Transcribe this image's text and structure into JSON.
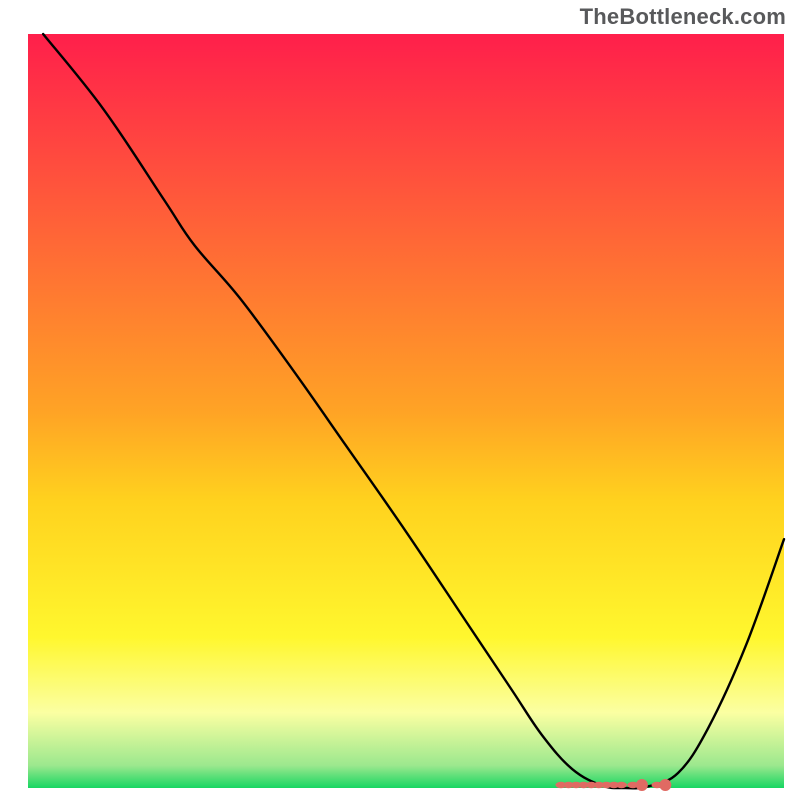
{
  "watermark": "TheBottleneck.com",
  "chart_data": {
    "type": "line",
    "title": "",
    "xlabel": "",
    "ylabel": "",
    "xlim": [
      0,
      100
    ],
    "ylim": [
      0,
      100
    ],
    "grid": false,
    "legend": false,
    "gradient_stops": [
      {
        "y_pct": 0,
        "color": "#ff1f4b"
      },
      {
        "y_pct": 50,
        "color": "#ffa325"
      },
      {
        "y_pct": 62,
        "color": "#ffd21e"
      },
      {
        "y_pct": 80,
        "color": "#fff72e"
      },
      {
        "y_pct": 90,
        "color": "#fbffa2"
      },
      {
        "y_pct": 97,
        "color": "#9ce88e"
      },
      {
        "y_pct": 100,
        "color": "#17d662"
      }
    ],
    "series": [
      {
        "name": "bottleneck-curve",
        "color": "#000000",
        "stroke_width": 2.4,
        "x": [
          2,
          10,
          18,
          22,
          28,
          35,
          42,
          50,
          58,
          64,
          68,
          72,
          76,
          79,
          82,
          86,
          90,
          95,
          100
        ],
        "y": [
          100,
          90,
          78,
          72,
          65,
          55.5,
          45.5,
          34,
          22,
          13,
          7,
          2.5,
          0.3,
          0,
          0.2,
          2,
          8,
          19,
          33
        ]
      }
    ],
    "markers": {
      "name": "optimal-band",
      "color": "#e06a63",
      "y": 0,
      "x_points": [
        70.5,
        71.5,
        72.5,
        73.5,
        74.5,
        75.5,
        76.5,
        77.5,
        78.5,
        80,
        81.2,
        83.2,
        84.3
      ]
    }
  }
}
